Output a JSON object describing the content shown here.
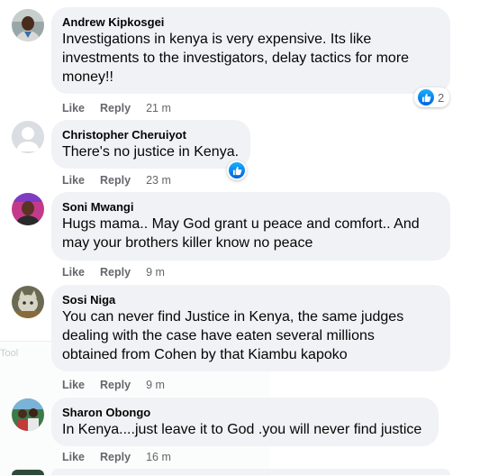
{
  "comments": [
    {
      "author": "Andrew Kipkosgei",
      "lines": [
        "Investigations in kenya is very expensive. Its like",
        "investments to the investigators, delay tactics for more",
        "money!!"
      ],
      "like": "Like",
      "reply": "Reply",
      "time": "21 m",
      "reactions": "2"
    },
    {
      "author": "Christopher Cheruiyot",
      "lines": [
        "There's no justice in Kenya."
      ],
      "like": "Like",
      "reply": "Reply",
      "time": "23 m"
    },
    {
      "author": "Soni Mwangi",
      "lines": [
        "Hugs mama.. May God grant u peace and comfort.. And",
        "may your brothers killer know no peace"
      ],
      "like": "Like",
      "reply": "Reply",
      "time": "9 m"
    },
    {
      "author": "Sosi Niga",
      "lines": [
        "You can never find Justice in Kenya, the same judges",
        "dealing with the case have eaten several millions",
        "obtained from Cohen by that Kiambu kapoko"
      ],
      "like": "Like",
      "reply": "Reply",
      "time": "9 m"
    },
    {
      "author": "Sharon Obongo",
      "lines": [
        "In Kenya....just leave it to God .you will never find justice"
      ],
      "like": "Like",
      "reply": "Reply",
      "time": "16 m"
    }
  ],
  "overlay_text": "Tool",
  "colors": {
    "bubble": "#f0f2f5",
    "meta": "#65676b",
    "like_blue": "#1877f2"
  }
}
